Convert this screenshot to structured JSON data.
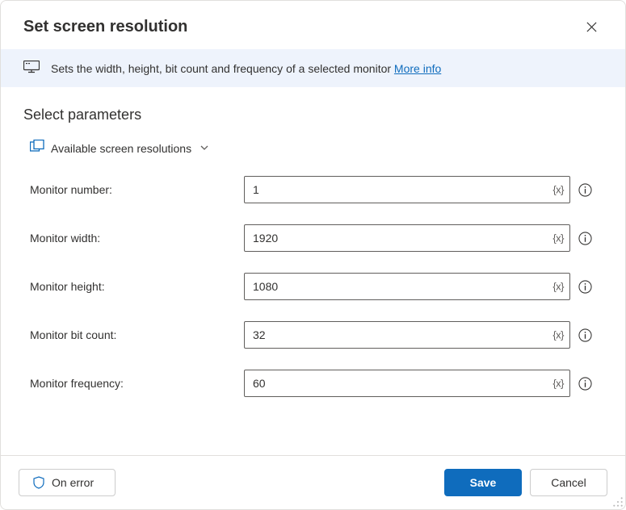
{
  "header": {
    "title": "Set screen resolution"
  },
  "banner": {
    "text": "Sets the width, height, bit count and frequency of a selected monitor ",
    "more_link": "More info"
  },
  "section": {
    "title": "Select parameters",
    "variables_label": "Available screen resolutions"
  },
  "params": {
    "monitor_number": {
      "label": "Monitor number:",
      "value": "1"
    },
    "monitor_width": {
      "label": "Monitor width:",
      "value": "1920"
    },
    "monitor_height": {
      "label": "Monitor height:",
      "value": "1080"
    },
    "monitor_bit_count": {
      "label": "Monitor bit count:",
      "value": "32"
    },
    "monitor_frequency": {
      "label": "Monitor frequency:",
      "value": "60"
    }
  },
  "token_hint": "{x}",
  "footer": {
    "on_error": "On error",
    "save": "Save",
    "cancel": "Cancel"
  }
}
